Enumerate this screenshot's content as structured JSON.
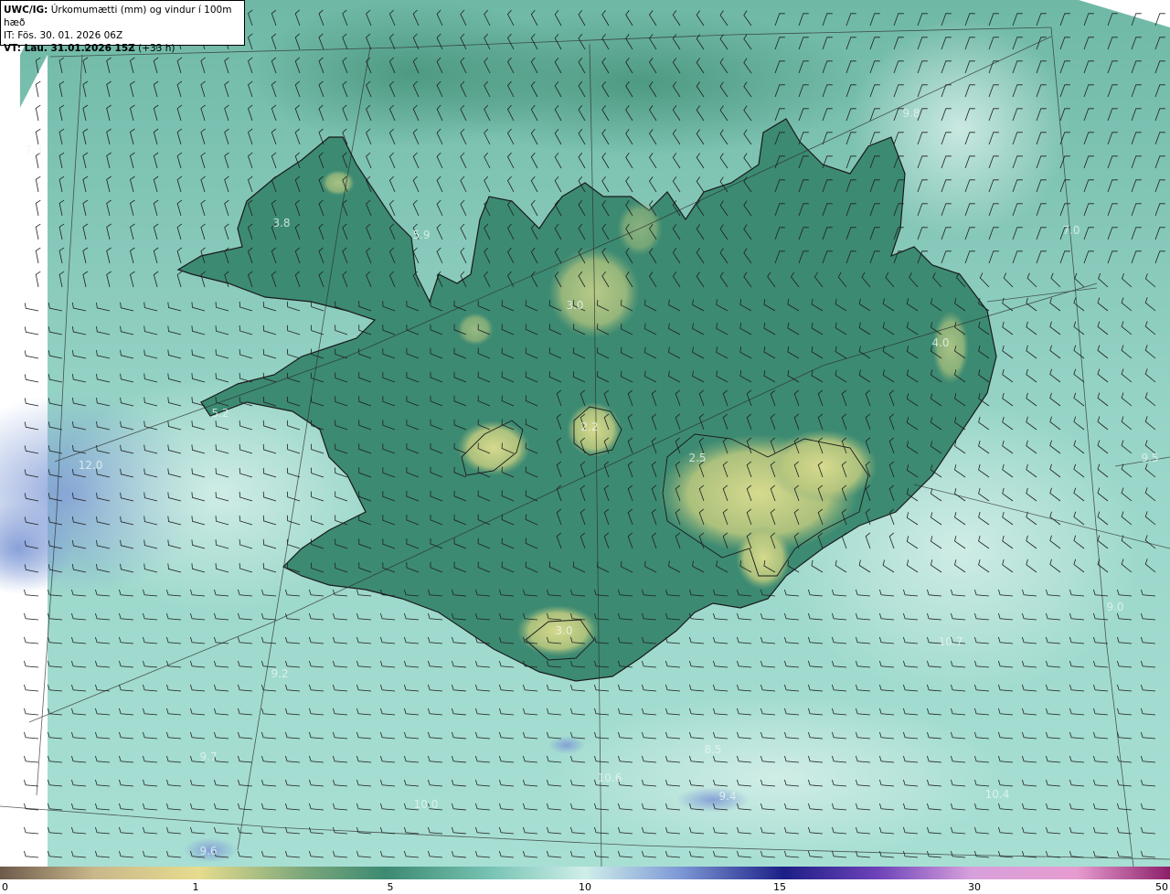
{
  "header": {
    "product": "UWC/IG:",
    "title": " Úrkomumætti (mm) og vindur í 100m hæð",
    "issue_time": "IT: Fös. 30. 01. 2026 06Z",
    "valid_time_bold": "VT: Lau. 31.01.2026 15Z",
    "lead_time": " (+33 h)"
  },
  "map_labels": [
    {
      "text": "7.3"
    },
    {
      "text": "3.8"
    },
    {
      "text": "5.9"
    },
    {
      "text": "3.0"
    },
    {
      "text": "9.8"
    },
    {
      "text": "7.0"
    },
    {
      "text": "4.0"
    },
    {
      "text": "5.2"
    },
    {
      "text": "2.2"
    },
    {
      "text": "2.5"
    },
    {
      "text": "12.0"
    },
    {
      "text": "9.5"
    },
    {
      "text": "9.0"
    },
    {
      "text": "3.0"
    },
    {
      "text": "10.7"
    },
    {
      "text": "9.2"
    },
    {
      "text": "9.7"
    },
    {
      "text": "8.5"
    },
    {
      "text": "10.6"
    },
    {
      "text": "10.0"
    },
    {
      "text": "10.4"
    },
    {
      "text": "9.4"
    },
    {
      "text": "9.6"
    }
  ],
  "colors": {
    "sea": "#9ed8cc",
    "low_land": "#3c8a72",
    "dry_land": "#cfd58a",
    "wet_sea": "#7f9ad6",
    "coastline": "#1a1a1a",
    "barbs": "#1f1f1f"
  },
  "colorbar": {
    "ticks": [
      {
        "label": "0"
      },
      {
        "label": "1"
      },
      {
        "label": "5"
      },
      {
        "label": "10"
      },
      {
        "label": "15"
      },
      {
        "label": "30"
      },
      {
        "label": "50"
      }
    ]
  }
}
